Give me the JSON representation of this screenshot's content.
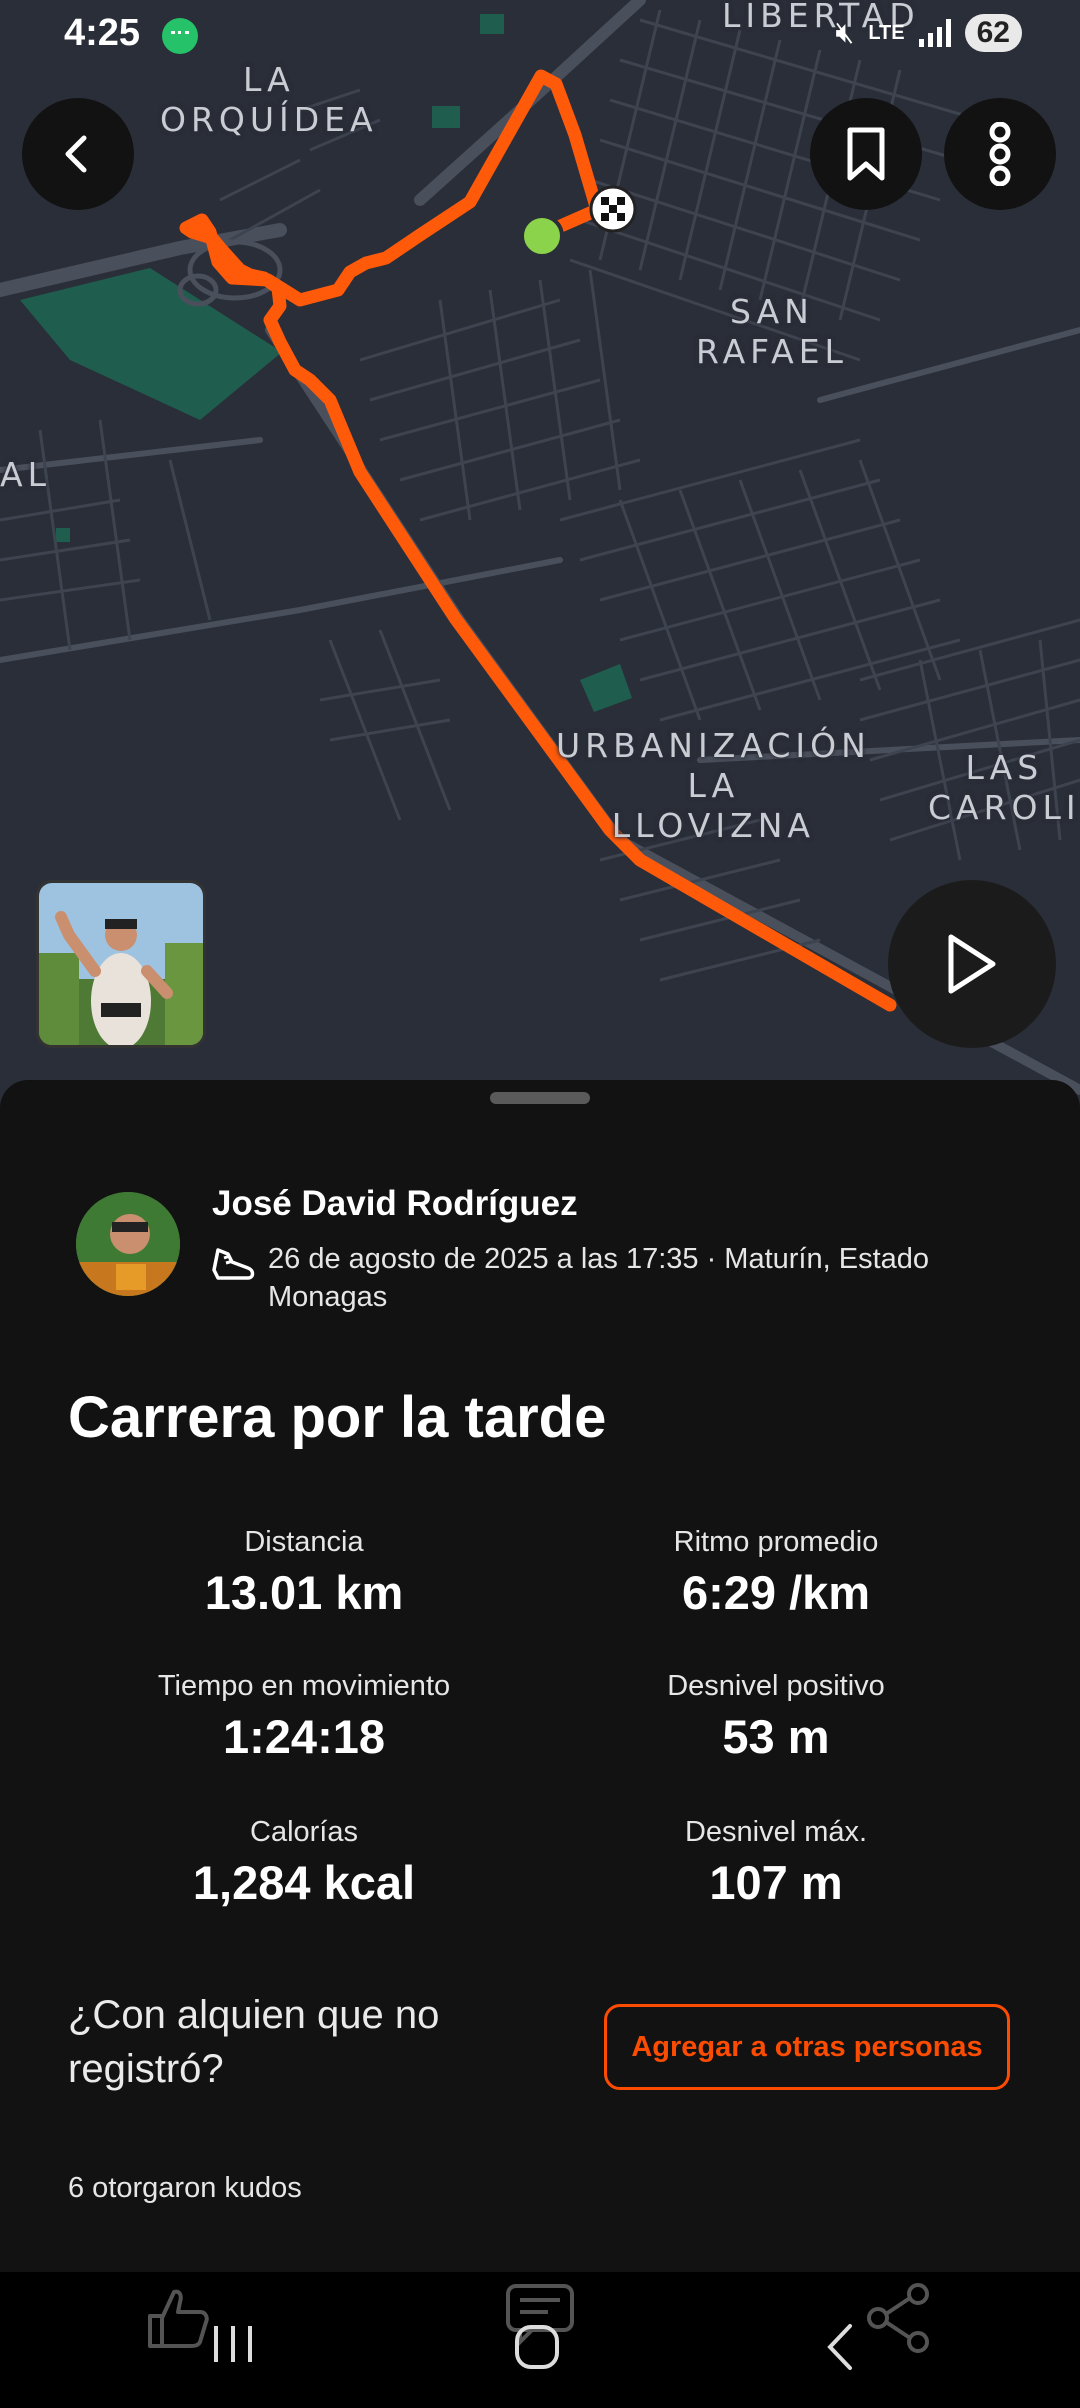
{
  "status_bar": {
    "time": "4:25",
    "lte": "LTE",
    "battery": "62"
  },
  "map": {
    "labels": [
      "LIBERTAD",
      "LA\nORQUÍDEA",
      "SAN\nRAFAEL",
      "AL",
      "URBANIZACIÓN\nLA\nLLOVIZNA",
      "LAS\nCAROLI"
    ]
  },
  "icons": {
    "back": "chevron-left-icon",
    "bookmark": "bookmark-icon",
    "more": "more-vertical-icon",
    "play": "play-icon",
    "shoe": "running-shoe-icon",
    "like": "thumbs-up-icon",
    "comment": "comment-icon",
    "share": "share-icon"
  },
  "athlete": {
    "name": "José David Rodríguez",
    "meta": "26 de agosto de 2025 a las 17:35 · Maturín, Estado Monagas"
  },
  "activity": {
    "title": "Carrera por la tarde",
    "stats": [
      {
        "label": "Distancia",
        "value": "13.01 km"
      },
      {
        "label": "Ritmo promedio",
        "value": "6:29 /km"
      },
      {
        "label": "Tiempo en movimiento",
        "value": "1:24:18"
      },
      {
        "label": "Desnivel positivo",
        "value": "53 m"
      },
      {
        "label": "Calorías",
        "value": "1,284 kcal"
      },
      {
        "label": "Desnivel máx.",
        "value": "107 m"
      }
    ]
  },
  "tag_others": {
    "question": "¿Con alquien que no registró?",
    "button": "Agregar a otras personas"
  },
  "kudos_text": "6 otorgaron kudos",
  "colors": {
    "accent": "#fc4c02",
    "route": "#ff5a0a",
    "start": "#8bd34a",
    "park": "#1f5e4e"
  }
}
